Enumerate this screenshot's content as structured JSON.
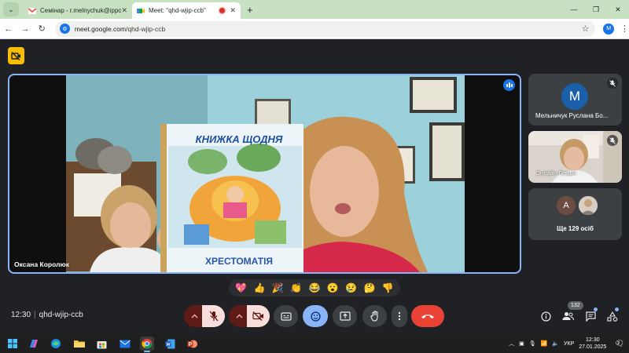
{
  "browser": {
    "tabs": [
      {
        "title": "Семінар - r.melnychuk@ippo.o",
        "active": false
      },
      {
        "title": "Meet: \"qhd-wjip-ccb\"",
        "active": true
      }
    ],
    "url_host": "meet.google.com",
    "url_path": "/qhd-wjip-ccb",
    "profile_initial": "M"
  },
  "meet": {
    "main_tile": {
      "participant": "Оксана Королюк",
      "book_title": "КНИЖКА ЩОДНЯ",
      "book_subtitle": "ХРЕСТОМАТІЯ"
    },
    "side_tiles": [
      {
        "avatar": "M",
        "name": "Мельничук Руслана Бо...",
        "muted": true
      },
      {
        "name": "Онлайн Лекція",
        "muted": true
      },
      {
        "avatar": "A",
        "name": "Ще 129 осіб"
      }
    ],
    "reactions": [
      "💖",
      "👍",
      "🎉",
      "👏",
      "😂",
      "😮",
      "😢",
      "🤔",
      "👎"
    ],
    "time": "12:30",
    "meeting_code": "qhd-wjip-ccb",
    "participants_count": "132"
  },
  "taskbar": {
    "language": "УКР",
    "clock_time": "12:30",
    "clock_date": "27.01.2025",
    "notifications": "2"
  },
  "colors": {
    "meet_bg": "#202124",
    "active_border": "#8ab4f8",
    "end_call": "#ea4335",
    "warning_badge": "#fbbc04"
  }
}
